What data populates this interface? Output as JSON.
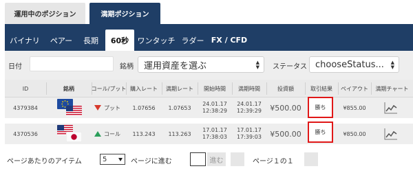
{
  "top_tabs": [
    "運用中のポジション",
    "満期ポジション"
  ],
  "subnav": [
    "バイナリ",
    "ペアー",
    "長期",
    "60秒",
    "ワンタッチ",
    "ラダー",
    "FX / CFD"
  ],
  "filter": {
    "date_label": "日付",
    "asset_label": "銘柄",
    "asset_select": "運用資産を選ぶ",
    "status_label": "ステータス",
    "status_select": "chooseStatus..."
  },
  "columns": [
    "ID",
    "銘柄",
    "コール/プット",
    "購入レート",
    "満期レート",
    "開始時間",
    "満期時間",
    "投資額",
    "取引結果",
    "ペイアウト",
    "満期チャート"
  ],
  "rows": [
    {
      "id": "4379384",
      "pair_icons": [
        "eu-flag-icon",
        "us-flag-icon"
      ],
      "direction": "プット",
      "direction_icon": "down-arrow-icon",
      "buy_rate": "1.07656",
      "expiry_rate": "1.07653",
      "start_date": "24.01.17",
      "start_time": "12:38:29",
      "expiry_date": "24.01.17",
      "expiry_time": "12:39:29",
      "amount": "¥500.00",
      "result": "勝ち",
      "payout": "¥855.00"
    },
    {
      "id": "4370536",
      "pair_icons": [
        "us-flag-icon",
        "jp-flag-icon"
      ],
      "direction": "コール",
      "direction_icon": "up-arrow-icon",
      "buy_rate": "113.243",
      "expiry_rate": "113.263",
      "start_date": "17.01.17",
      "start_time": "17:38:03",
      "expiry_date": "17.01.17",
      "expiry_time": "17:39:03",
      "amount": "¥500.00",
      "result": "勝ち",
      "payout": "¥850.00"
    }
  ],
  "footer": {
    "per_page_label": "ページあたりのアイテム",
    "per_page_value": "5",
    "goto_label": "ページに進む",
    "go_button": "進む",
    "page_info": "ページ１の１"
  },
  "colors": {
    "nav": "#1f3e66",
    "put": "#d7392c",
    "call": "#2a9e5a",
    "highlight": "#e01717"
  }
}
